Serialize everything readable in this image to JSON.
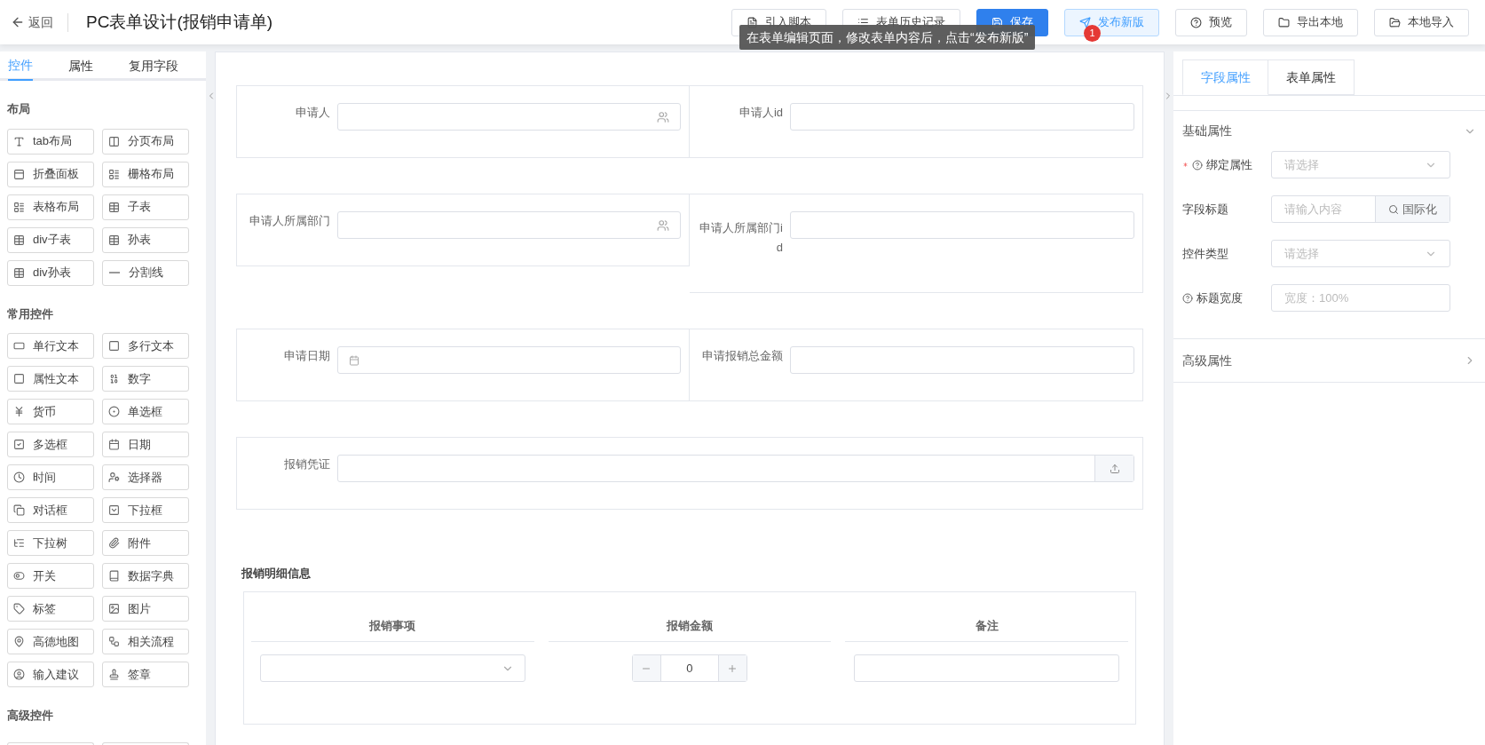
{
  "header": {
    "back": "返回",
    "title": "PC表单设计(报销申请单)",
    "buttons": [
      {
        "label": "引入脚本",
        "kind": "script"
      },
      {
        "label": "表单历史记录",
        "kind": "history"
      },
      {
        "label": "保存",
        "kind": "save"
      },
      {
        "label": "发布新版",
        "kind": "publish"
      },
      {
        "label": "预览",
        "kind": "preview"
      },
      {
        "label": "导出本地",
        "kind": "export"
      },
      {
        "label": "本地导入",
        "kind": "import"
      }
    ],
    "tooltip": {
      "text": "在表单编辑页面，修改表单内容后，点击“发布新版”",
      "badge": "1"
    }
  },
  "sidebar": {
    "tabs": [
      {
        "label": "控件",
        "selected": true
      },
      {
        "label": "属性",
        "selected": false
      },
      {
        "label": "复用字段",
        "selected": false
      }
    ],
    "groups": [
      {
        "title": "布局",
        "items": [
          "tab布局",
          "分页布局",
          "折叠面板",
          "栅格布局",
          "表格布局",
          "子表",
          "div子表",
          "孙表",
          "div孙表",
          "分割线"
        ]
      },
      {
        "title": "常用控件",
        "items": [
          "单行文本",
          "多行文本",
          "属性文本",
          "数字",
          "货币",
          "单选框",
          "多选框",
          "日期",
          "时间",
          "选择器",
          "对话框",
          "下拉框",
          "下拉树",
          "附件",
          "开关",
          "数据字典",
          "标签",
          "图片",
          "高德地图",
          "相关流程",
          "输入建议",
          "签章"
        ]
      },
      {
        "title": "高级控件"
      }
    ]
  },
  "form": {
    "rows": [
      {
        "fields": [
          {
            "label": "申请人",
            "kind": "user"
          },
          {
            "label": "申请人id",
            "kind": "text"
          }
        ]
      },
      {
        "fields": [
          {
            "label": "申请人所属部门",
            "kind": "user"
          },
          {
            "label": "申请人所属部门id",
            "kind": "text"
          }
        ]
      },
      {
        "fields": [
          {
            "label": "申请日期",
            "kind": "date"
          },
          {
            "label": "申请报销总金额",
            "kind": "text"
          }
        ]
      },
      {
        "fields": [
          {
            "label": "报销凭证",
            "kind": "upload"
          }
        ]
      }
    ],
    "subtable": {
      "title": "报销明细信息",
      "columns": [
        {
          "label": "报销事项",
          "kind": "select"
        },
        {
          "label": "报销金额",
          "kind": "number",
          "value": "0"
        },
        {
          "label": "备注",
          "kind": "text"
        }
      ]
    }
  },
  "props": {
    "tabs": [
      {
        "label": "字段属性",
        "selected": true
      },
      {
        "label": "表单属性",
        "selected": false
      }
    ],
    "basic": {
      "title": "基础属性",
      "expanded": true,
      "rows": [
        {
          "label": "绑定属性",
          "required": true,
          "help": true,
          "kind": "select",
          "placeholder": "请选择"
        },
        {
          "label": "字段标题",
          "required": false,
          "help": false,
          "kind": "i18n",
          "placeholder": "请输入内容",
          "button": "国际化"
        },
        {
          "label": "控件类型",
          "required": false,
          "help": false,
          "kind": "select",
          "placeholder": "请选择"
        },
        {
          "label": "标题宽度",
          "required": false,
          "help": true,
          "kind": "text",
          "placeholder": "宽度：100%"
        }
      ]
    },
    "advanced": {
      "title": "高级属性",
      "expanded": false
    }
  }
}
